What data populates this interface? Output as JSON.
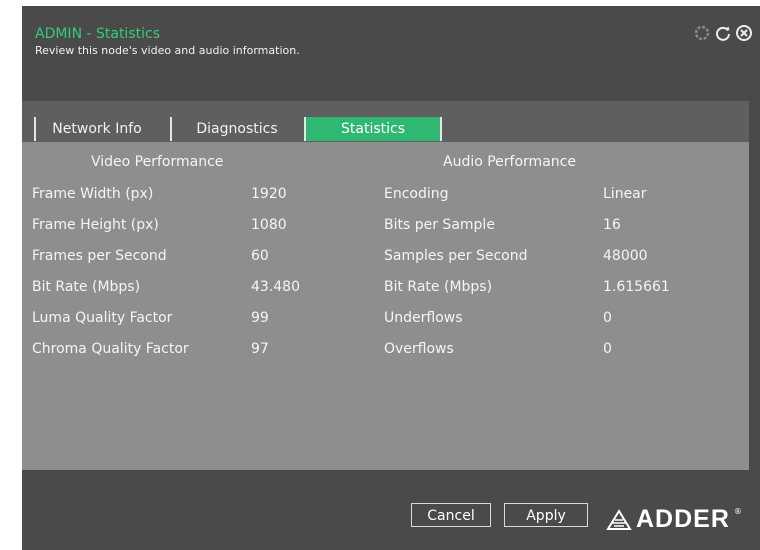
{
  "header": {
    "title": "ADMIN - Statistics",
    "subtitle": "Review this node's video and audio information."
  },
  "icons": {
    "top": [
      "gear-icon",
      "refresh-icon",
      "close-icon"
    ]
  },
  "tabs": [
    {
      "label": "Network Info",
      "active": false
    },
    {
      "label": "Diagnostics",
      "active": false
    },
    {
      "label": "Statistics",
      "active": true
    }
  ],
  "video": {
    "heading": "Video Performance",
    "rows": [
      {
        "label": "Frame Width (px)",
        "value": "1920"
      },
      {
        "label": "Frame Height (px)",
        "value": "1080"
      },
      {
        "label": "Frames per Second",
        "value": "60"
      },
      {
        "label": "Bit Rate (Mbps)",
        "value": "43.480"
      },
      {
        "label": "Luma Quality Factor",
        "value": "99"
      },
      {
        "label": "Chroma Quality Factor",
        "value": "97"
      }
    ]
  },
  "audio": {
    "heading": "Audio Performance",
    "rows": [
      {
        "label": "Encoding",
        "value": "Linear"
      },
      {
        "label": "Bits per Sample",
        "value": "16"
      },
      {
        "label": "Samples per Second",
        "value": "48000"
      },
      {
        "label": "Bit Rate (Mbps)",
        "value": "1.615661"
      },
      {
        "label": "Underflows",
        "value": "0"
      },
      {
        "label": "Overflows",
        "value": "0"
      }
    ]
  },
  "footer": {
    "cancel_label": "Cancel",
    "apply_label": "Apply",
    "brand": "ADDER",
    "brand_mark": "®"
  },
  "colors": {
    "accent": "#2fb871",
    "title": "#33cc7a",
    "panel": "#4a4a4a",
    "tabbar": "#5f5f5f",
    "content": "#8e8e8e"
  }
}
